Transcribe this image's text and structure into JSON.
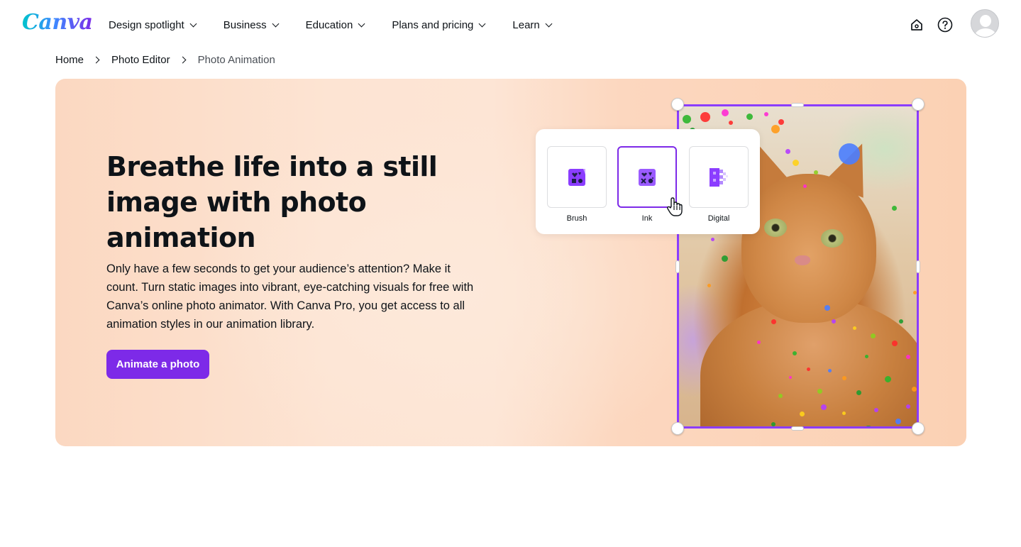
{
  "header": {
    "logo_text": "Canva",
    "nav": [
      {
        "label": "Design spotlight"
      },
      {
        "label": "Business"
      },
      {
        "label": "Education"
      },
      {
        "label": "Plans and pricing"
      },
      {
        "label": "Learn"
      }
    ],
    "icons": [
      "home-icon",
      "help-icon",
      "avatar"
    ]
  },
  "breadcrumb": [
    {
      "label": "Home"
    },
    {
      "label": "Photo Editor"
    },
    {
      "label": "Photo Animation"
    }
  ],
  "hero": {
    "title": "Breathe life into a still image with photo animation",
    "description": "Only have a few seconds to get your audience’s attention? Make it count. Turn static images into vibrant, eye-catching visuals for free with Canva’s online photo animator. With Canva Pro, you get access to all animation styles in our animation library.",
    "cta_label": "Animate a photo",
    "styles": [
      {
        "label": "Brush",
        "icon": "brush-style-icon",
        "selected": false
      },
      {
        "label": "Ink",
        "icon": "ink-style-icon",
        "selected": true
      },
      {
        "label": "Digital",
        "icon": "digital-style-icon",
        "selected": false
      }
    ]
  },
  "colors": {
    "accent": "#7d2ae8",
    "text": "#0e1318",
    "hero_bg": "#fde0cc"
  }
}
